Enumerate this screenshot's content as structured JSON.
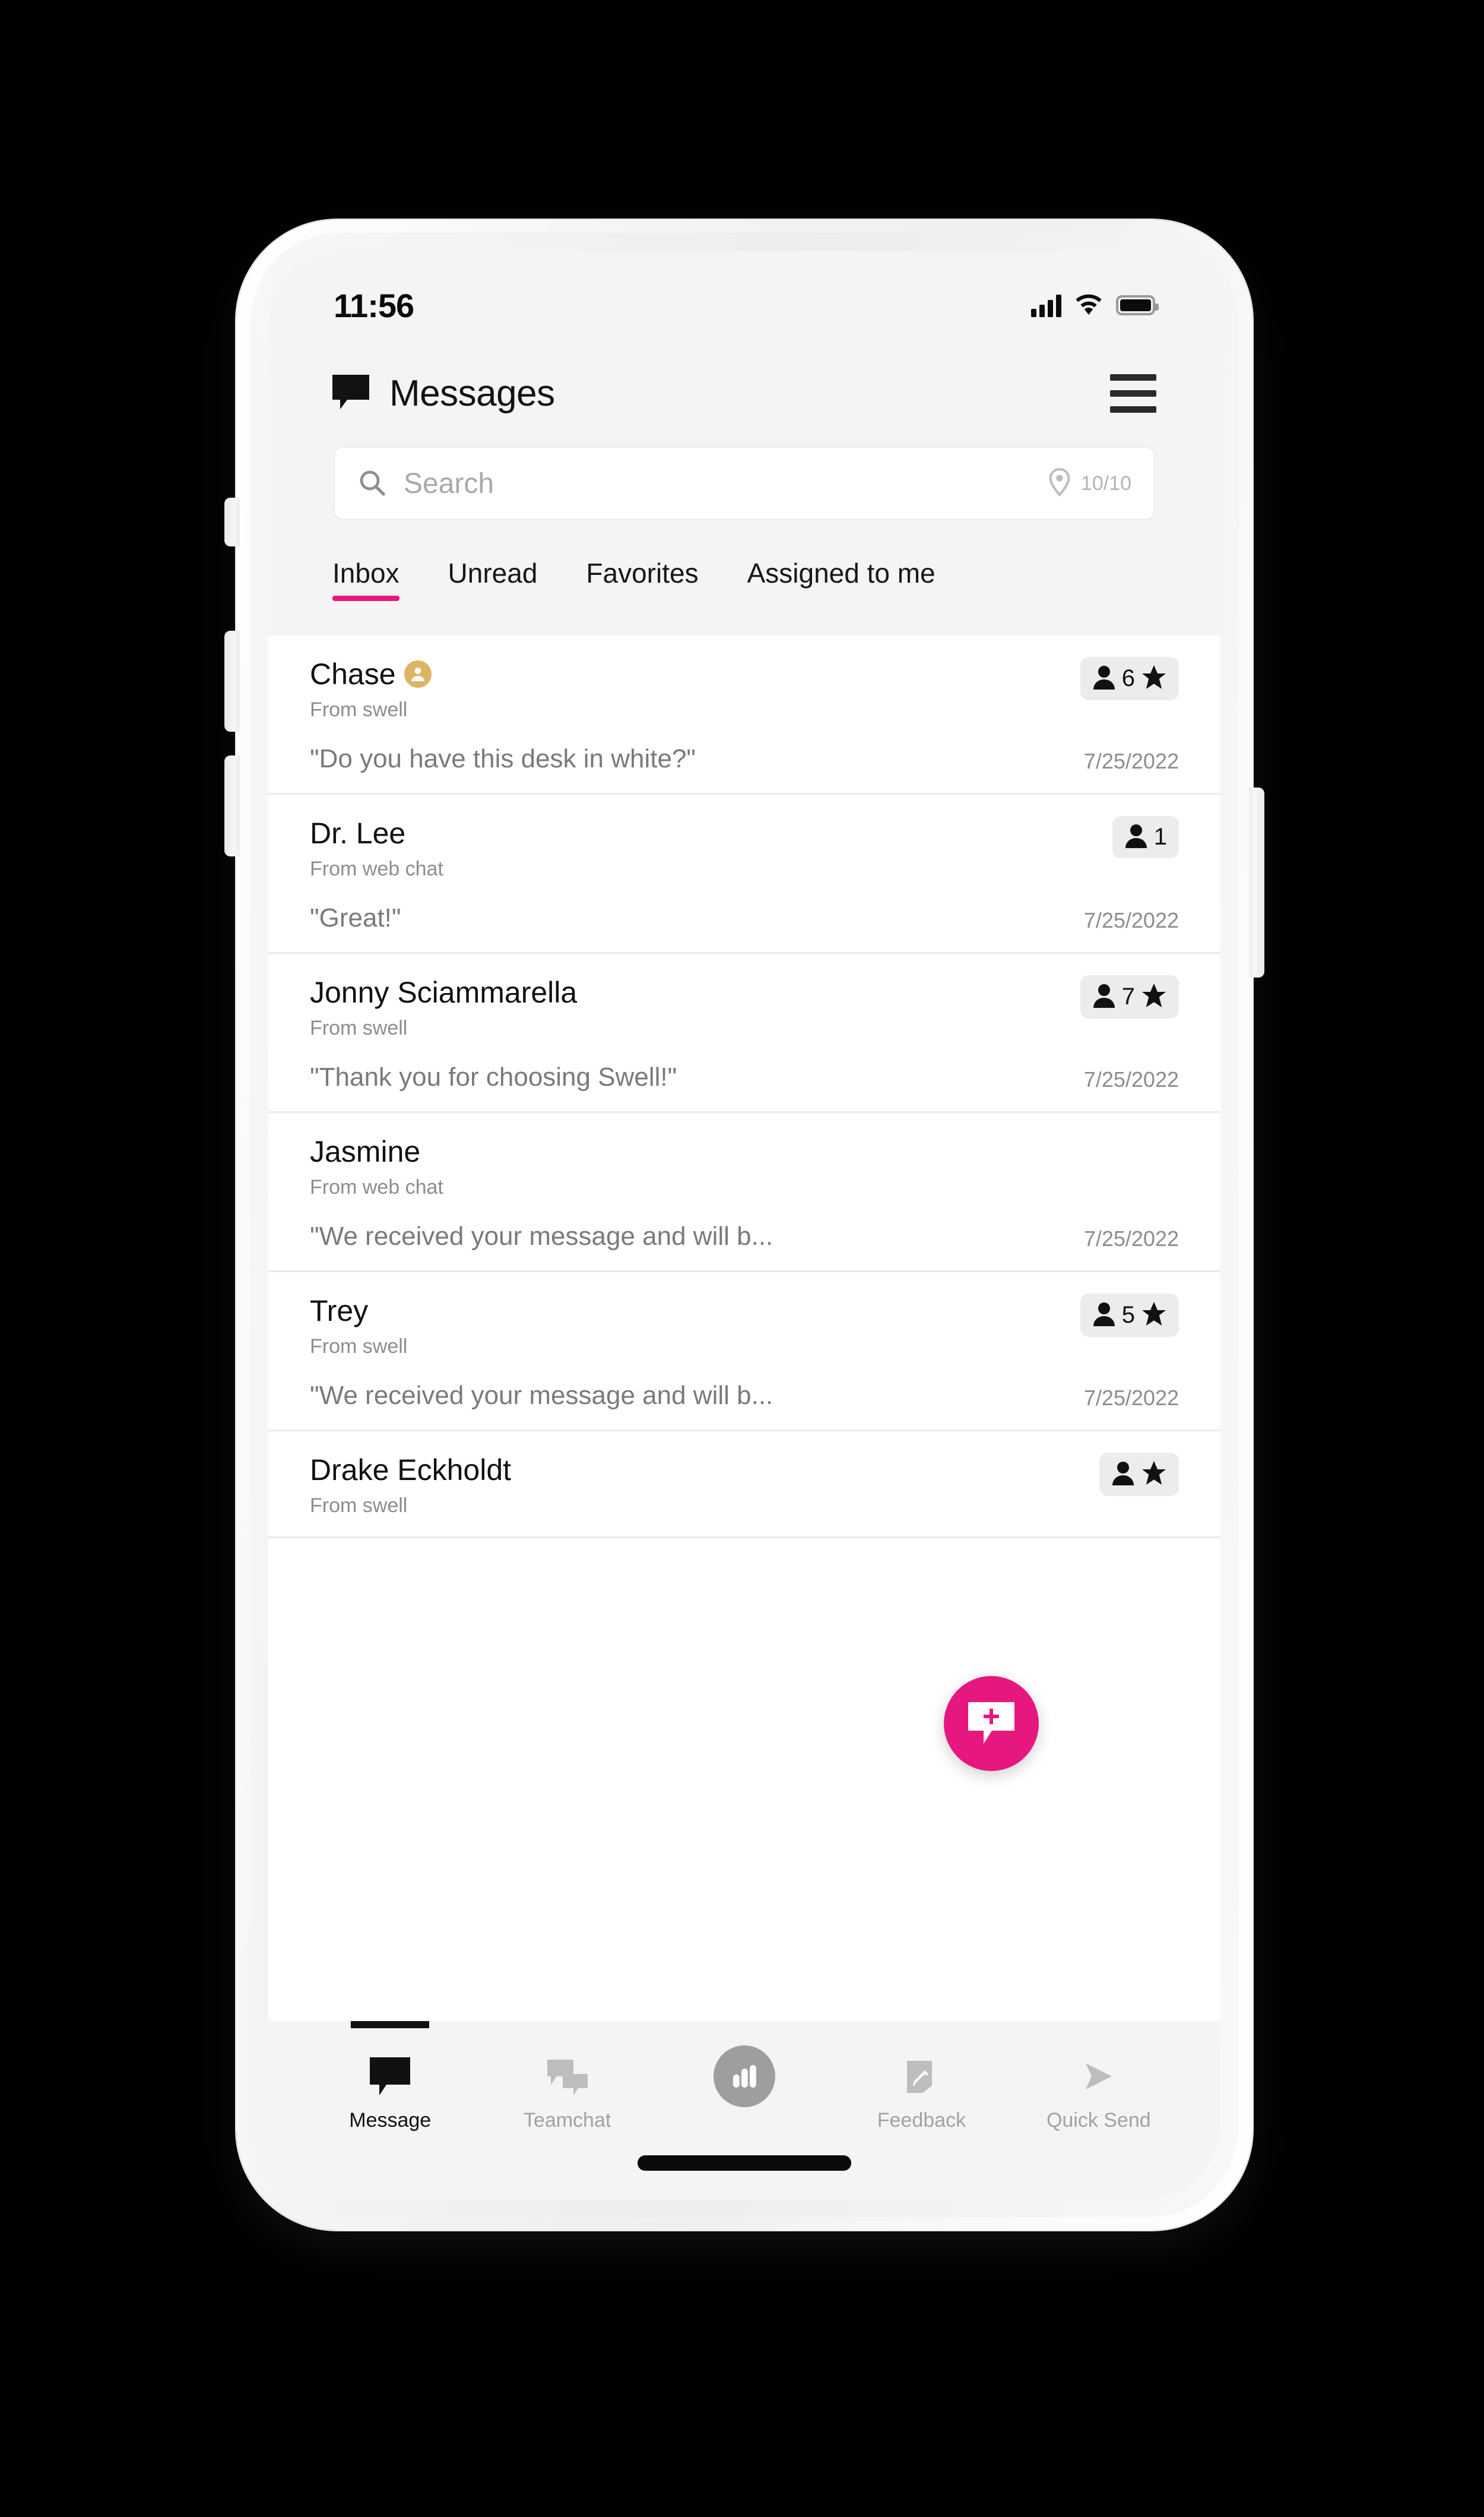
{
  "status_bar": {
    "time": "11:56",
    "signal_icon": "cellular-signal-icon",
    "wifi_icon": "wifi-icon",
    "battery_icon": "battery-icon"
  },
  "header": {
    "title": "Messages",
    "logo_icon": "chat-bubble-icon",
    "menu_icon": "hamburger-menu-icon"
  },
  "search": {
    "placeholder": "Search",
    "search_icon": "search-icon",
    "location_icon": "location-pin-icon",
    "location_count": "10/10"
  },
  "tabs": [
    {
      "label": "Inbox",
      "active": true
    },
    {
      "label": "Unread",
      "active": false
    },
    {
      "label": "Favorites",
      "active": false
    },
    {
      "label": "Assigned to me",
      "active": false
    }
  ],
  "messages": [
    {
      "name": "Chase",
      "source": "From swell",
      "preview": "\"Do you have this desk in white?\"",
      "date": "7/25/2022",
      "count": "6",
      "has_badge": true,
      "has_star": true,
      "has_avatar": true
    },
    {
      "name": "Dr. Lee",
      "source": "From web chat",
      "preview": "\"Great!\"",
      "date": "7/25/2022",
      "count": "1",
      "has_badge": true,
      "has_star": false,
      "has_avatar": false
    },
    {
      "name": "Jonny Sciammarella",
      "source": "From swell",
      "preview": "\"Thank you for choosing Swell!\"",
      "date": "7/25/2022",
      "count": "7",
      "has_badge": true,
      "has_star": true,
      "has_avatar": false
    },
    {
      "name": "Jasmine",
      "source": "From web chat",
      "preview": "\"We received your message and will b...",
      "date": "7/25/2022",
      "count": "",
      "has_badge": false,
      "has_star": false,
      "has_avatar": false
    },
    {
      "name": "Trey",
      "source": "From swell",
      "preview": "\"We received your message and will b...",
      "date": "7/25/2022",
      "count": "5",
      "has_badge": true,
      "has_star": true,
      "has_avatar": false
    },
    {
      "name": "Drake Eckholdt",
      "source": "From swell",
      "preview": "",
      "date": "",
      "count": "",
      "has_badge": true,
      "has_star": true,
      "has_avatar": false
    }
  ],
  "fab": {
    "icon": "compose-message-icon",
    "label": "New message"
  },
  "bottom_nav": [
    {
      "label": "Message",
      "icon": "message-bubble-icon",
      "active": true
    },
    {
      "label": "Teamchat",
      "icon": "teamchat-bubbles-icon",
      "active": false
    },
    {
      "label": "",
      "icon": "analytics-bars-icon",
      "active": false
    },
    {
      "label": "Feedback",
      "icon": "feedback-pencil-icon",
      "active": false
    },
    {
      "label": "Quick Send",
      "icon": "send-arrow-icon",
      "active": false
    }
  ],
  "colors": {
    "accent_pink": "#e6187f",
    "avatar_gold": "#ddb464",
    "screen_bg": "#f4f4f4",
    "list_bg": "#ffffff"
  }
}
